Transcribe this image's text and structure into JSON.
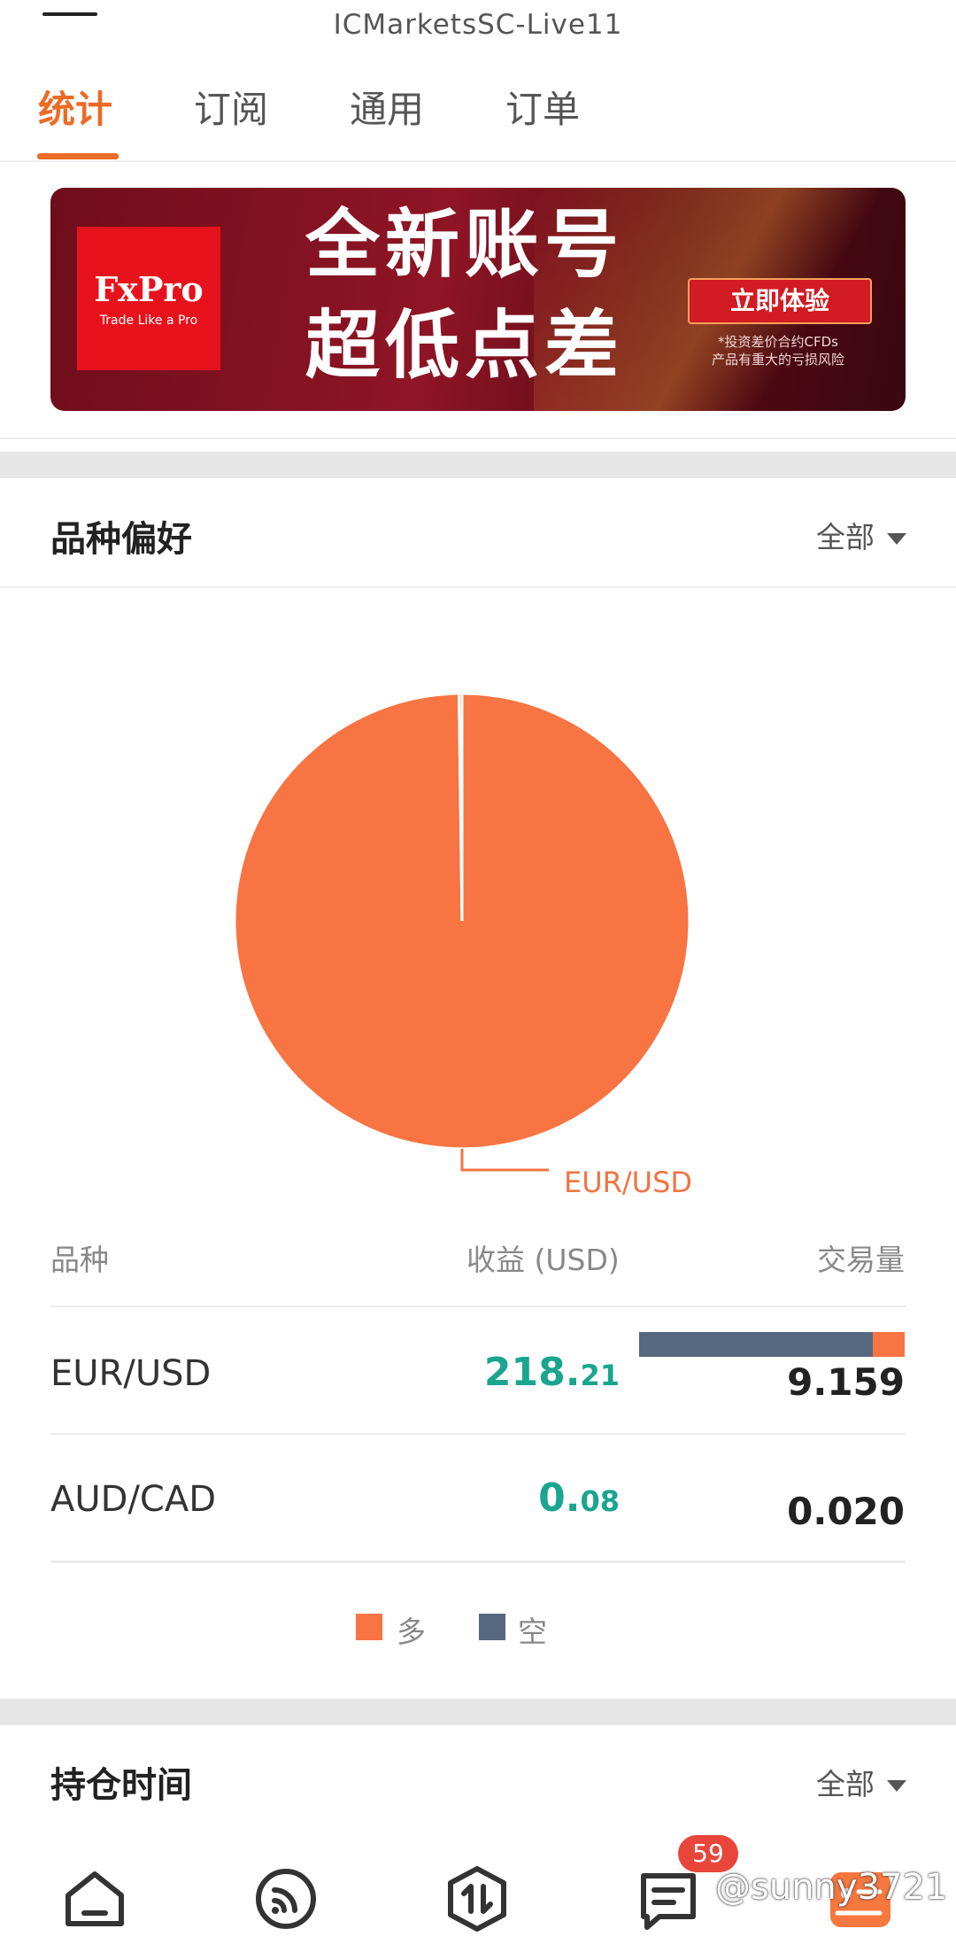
{
  "header": {
    "server_name": "ICMarketsSC-Live11"
  },
  "tabs": [
    {
      "label": "统计",
      "active": true
    },
    {
      "label": "订阅",
      "active": false
    },
    {
      "label": "通用",
      "active": false
    },
    {
      "label": "订单",
      "active": false
    }
  ],
  "banner": {
    "brand": "FxPro",
    "tagline": "Trade Like a Pro",
    "line1": "全新账号",
    "line2": "超低点差",
    "cta": "立即体验",
    "risk_line1": "*投资差价合约CFDs",
    "risk_line2": "产品有重大的亏损风险"
  },
  "symbol_preference": {
    "title": "品种偏好",
    "filter": "全部",
    "columns": {
      "symbol": "品种",
      "profit": "收益 (USD)",
      "volume": "交易量"
    },
    "rows": [
      {
        "symbol": "EUR/USD",
        "profit_int": "218.",
        "profit_dec": "21",
        "volume": "9.159",
        "long_share": 0.12,
        "short_share": 0.88
      },
      {
        "symbol": "AUD/CAD",
        "profit_int": "0.",
        "profit_dec": "08",
        "volume": "0.020"
      }
    ],
    "legend": {
      "long": "多",
      "short": "空"
    }
  },
  "chart_data": {
    "type": "pie",
    "slices": [
      {
        "label": "EUR/USD",
        "value": 9.159,
        "color": "#f87442"
      },
      {
        "label": "AUD/CAD",
        "value": 0.02,
        "color": "#f87442"
      }
    ],
    "labeled_slice": "EUR/USD"
  },
  "holding_time": {
    "title": "持仓时间",
    "filter": "全部"
  },
  "nav": {
    "items": [
      "home-icon",
      "signal-feed-icon",
      "trade-icon",
      "messages-icon",
      "profile-icon"
    ],
    "message_badge": "59"
  },
  "watermark": "@sunny3721",
  "colors": {
    "accent": "#ec6b25",
    "long": "#f87442",
    "short": "#566780",
    "profit": "#1aa58e"
  }
}
